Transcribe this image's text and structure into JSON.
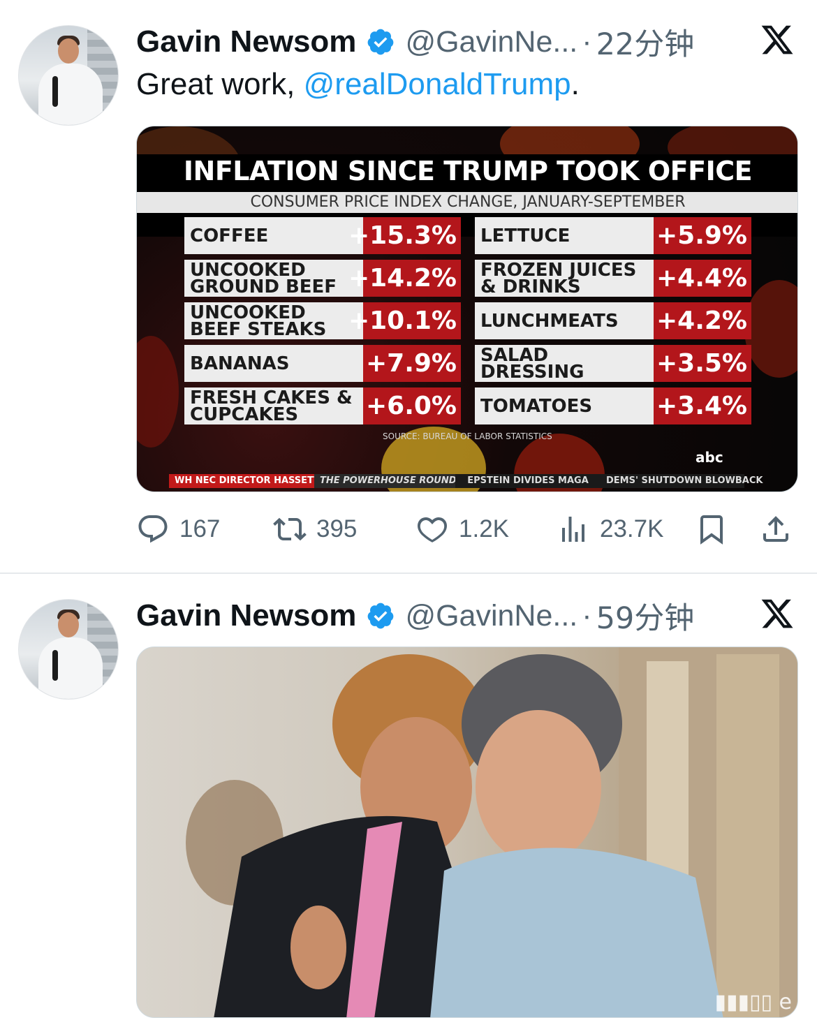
{
  "tweets": [
    {
      "author": "Gavin Newsom",
      "handle": "@GavinNe...",
      "time": "22分钟",
      "text_prefix": "Great work, ",
      "mention": "@realDonaldTrump",
      "text_suffix": ".",
      "stats": {
        "replies": "167",
        "reposts": "395",
        "likes": "1.2K",
        "views": "23.7K"
      }
    },
    {
      "author": "Gavin Newsom",
      "handle": "@GavinNe...",
      "time": "59分钟"
    }
  ],
  "graphic": {
    "title": "INFLATION SINCE TRUMP TOOK OFFICE",
    "subtitle": "CONSUMER PRICE INDEX CHANGE, JANUARY-SEPTEMBER",
    "source": "SOURCE: BUREAU OF LABOR STATISTICS",
    "network": "abc",
    "ticker": [
      "WH NEC DIRECTOR HASSETT",
      "THE POWERHOUSE ROUNDTABLE",
      "EPSTEIN DIVIDES MAGA",
      "DEMS' SHUTDOWN BLOWBACK"
    ],
    "left_items": [
      {
        "label": "COFFEE",
        "value": "+15.3%"
      },
      {
        "label": "UNCOOKED\nGROUND BEEF",
        "value": "+14.2%"
      },
      {
        "label": "UNCOOKED\nBEEF STEAKS",
        "value": "+10.1%"
      },
      {
        "label": "BANANAS",
        "value": "+7.9%"
      },
      {
        "label": "FRESH CAKES &\nCUPCAKES",
        "value": "+6.0%"
      }
    ],
    "right_items": [
      {
        "label": "LETTUCE",
        "value": "+5.9%"
      },
      {
        "label": "FROZEN JUICES\n& DRINKS",
        "value": "+4.4%"
      },
      {
        "label": "LUNCHMEATS",
        "value": "+4.2%"
      },
      {
        "label": "SALAD\nDRESSING",
        "value": "+3.5%"
      },
      {
        "label": "TOMATOES",
        "value": "+3.4%"
      }
    ]
  },
  "icons": {
    "verified": "verified-badge-icon",
    "brand": "x-logo-icon"
  },
  "colors": {
    "verified": "#1d9bf0",
    "mention": "#1d9bf0",
    "muted": "#536471",
    "bar_red": "#b3161b"
  }
}
